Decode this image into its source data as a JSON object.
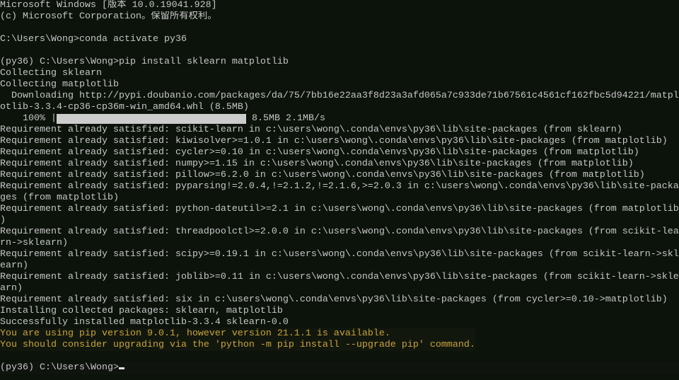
{
  "window": {
    "type": "windows-console"
  },
  "colors": {
    "background": "#0c130b",
    "text": "#c6c6c6",
    "warning": "#c9a43a"
  },
  "lines": [
    "Microsoft Windows [版本 10.0.19041.928]",
    "(c) Microsoft Corporation。保留所有权利。",
    "",
    "C:\\Users\\Wong>conda activate py36",
    "",
    "(py36) C:\\Users\\Wong>pip install sklearn matplotlib",
    "Collecting sklearn",
    "Collecting matplotlib",
    "  Downloading http://pypi.doubanio.com/packages/da/75/7bb16e22aa3f8d23a3afd065a7c933de71b67561c4561cf162fbc5d94221/matpl",
    "otlib-3.3.4-cp36-cp36m-win_amd64.whl (8.5MB)"
  ],
  "progress": {
    "percent_label": "    100% |",
    "value": 100,
    "stats": " 8.5MB 2.1MB/s"
  },
  "lines2": [
    "Requirement already satisfied: scikit-learn in c:\\users\\wong\\.conda\\envs\\py36\\lib\\site-packages (from sklearn)",
    "Requirement already satisfied: kiwisolver>=1.0.1 in c:\\users\\wong\\.conda\\envs\\py36\\lib\\site-packages (from matplotlib)",
    "Requirement already satisfied: cycler>=0.10 in c:\\users\\wong\\.conda\\envs\\py36\\lib\\site-packages (from matplotlib)",
    "Requirement already satisfied: numpy>=1.15 in c:\\users\\wong\\.conda\\envs\\py36\\lib\\site-packages (from matplotlib)",
    "Requirement already satisfied: pillow>=6.2.0 in c:\\users\\wong\\.conda\\envs\\py36\\lib\\site-packages (from matplotlib)",
    "Requirement already satisfied: pyparsing!=2.0.4,!=2.1.2,!=2.1.6,>=2.0.3 in c:\\users\\wong\\.conda\\envs\\py36\\lib\\site-packa",
    "ges (from matplotlib)",
    "Requirement already satisfied: python-dateutil>=2.1 in c:\\users\\wong\\.conda\\envs\\py36\\lib\\site-packages (from matplotlib",
    ")",
    "Requirement already satisfied: threadpoolctl>=2.0.0 in c:\\users\\wong\\.conda\\envs\\py36\\lib\\site-packages (from scikit-lea",
    "rn->sklearn)",
    "Requirement already satisfied: scipy>=0.19.1 in c:\\users\\wong\\.conda\\envs\\py36\\lib\\site-packages (from scikit-learn->skl",
    "earn)",
    "Requirement already satisfied: joblib>=0.11 in c:\\users\\wong\\.conda\\envs\\py36\\lib\\site-packages (from scikit-learn->skle",
    "arn)",
    "Requirement already satisfied: six in c:\\users\\wong\\.conda\\envs\\py36\\lib\\site-packages (from cycler>=0.10->matplotlib)",
    "Installing collected packages: sklearn, matplotlib",
    "Successfully installed matplotlib-3.3.4 sklearn-0.0"
  ],
  "warnings": [
    "You are using pip version 9.0.1, however version 21.1.1 is available.",
    "You should consider upgrading via the 'python -m pip install --upgrade pip' command."
  ],
  "prompt": "(py36) C:\\Users\\Wong>"
}
